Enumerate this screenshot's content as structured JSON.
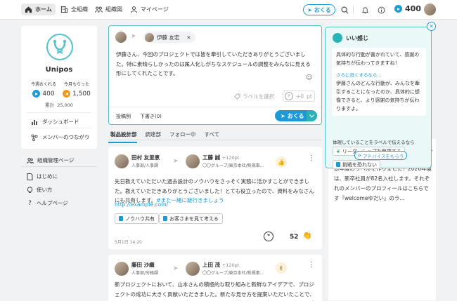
{
  "header": {
    "nav": [
      {
        "label": "ホーム",
        "icon": "home-icon"
      },
      {
        "label": "全組織",
        "icon": "building-icon"
      },
      {
        "label": "組織図",
        "icon": "org-chart-icon"
      },
      {
        "label": "マイページ",
        "icon": "user-icon"
      }
    ],
    "send_label": "おくる",
    "points": "400"
  },
  "profile": {
    "name": "Unipos",
    "sent_label": "今週おくれる",
    "sent_value": "400",
    "received_label": "今月もらった",
    "received_value": "1,500",
    "total_label": "累計",
    "total_value": "25,000",
    "menu": [
      "ダッシュボード",
      "メンバーのつながり"
    ]
  },
  "side_links": [
    "組織管理ページ",
    "はじめに",
    "使い方",
    "ヘルプページ"
  ],
  "compose": {
    "recipient": "伊藤 友宏",
    "message": "伊藤さん、今回のプロジェクトでは皆を牽引していただきありがとうございました。特に素晴らしかったのは属人化しがちなスケジュールの調整をみんなに見える形にしてくれたことです。",
    "label_placeholder": "ラベルを選択",
    "points": "+0",
    "points_unit": "pt",
    "examples_label": "投稿例",
    "drafts_label": "下書き(0)",
    "send_label": "おくる"
  },
  "tabs": [
    "製品設計部",
    "調達部",
    "フォロー中",
    "すべて"
  ],
  "posts": [
    {
      "sender_name": "田村 友里恵",
      "sender_dept": "人事部/人事課",
      "recipient_name": "工藤 誠",
      "recipient_points": "+120pt",
      "recipient_dept": "〇〇グループ/東京本社/新規事...",
      "text_before_tag": "先日教えていただいた過去設計のノウハウをさっそく実務に活かすことができました。教えていただきありがとうございました！とても役立ったので、資料をみなさんにも共有します。",
      "tag": "#また一緒に飯行きましょう",
      "link": "http://example.com/",
      "badges": [
        "ノウハウ共有",
        "お客さまを見て考える"
      ],
      "date": "5月1日 14:20",
      "claps": "52"
    },
    {
      "sender_name": "藤田 沙織",
      "sender_dept": "人事部/労務課",
      "recipient_name": "上田 茂",
      "recipient_points": "+120pt",
      "recipient_dept": "〇〇グループ/東京本社/新規事...",
      "text": "新プロジェクトにおいて、山本さんの積極的な取り組みと新鮮なアイデアで、プロジェクトの成功に大きく貢献いただきました。新たな見せ方を提案いただいたことで、いつもと違う製品の良さをアピールできました！会議を計画して課題に取り組み、成果を出せ"
    }
  ],
  "right_card": {
    "text": "新年度のラベルを作りました！2026年度は、新卒社員が82名入社します。それぞれのメンバーのプロフィールはこちらです『welcomeゆだい』のラ..."
  },
  "advice": {
    "title": "いい感じ",
    "bubble1": "具体的な行動が書かれていて、感謝の気持ちが伝わってきますね！",
    "better_label": "さらに良くするなら…",
    "bubble2": "伊藤さんのどんな行動が、みんなを牽引することになったのか、具体的に想像できると、より感謝の気持ちが伝わりますよ。",
    "labels_caption": "体現していることをラベルで伝えるなら",
    "chips": [
      "リーダーシップを発揮する",
      "挑戦を恐れない"
    ],
    "more_label": "アドバイスをもらう"
  },
  "colors": {
    "primary": "#1d9ad6",
    "accent": "#53c3c6",
    "orange": "#f29a1f"
  }
}
